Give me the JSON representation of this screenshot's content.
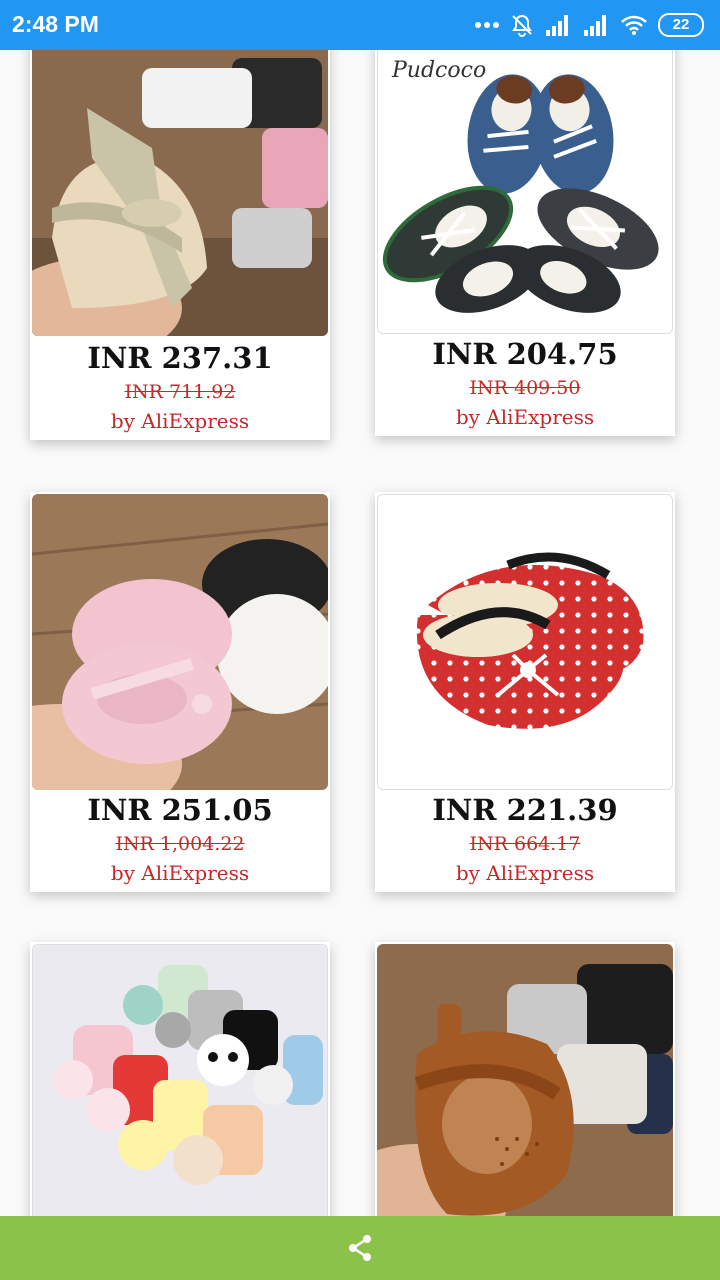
{
  "status_bar": {
    "time": "2:48 PM",
    "battery": "22"
  },
  "products": [
    {
      "price": "INR 237.31",
      "original_price": "INR 711.92",
      "seller": "by AliExpress",
      "image": "silver-glitter-baby-sandals"
    },
    {
      "price": "INR 204.75",
      "original_price": "INR 409.50",
      "seller": "by AliExpress",
      "image": "baby-boat-shoes",
      "brand_mark": "Pudcoco"
    },
    {
      "price": "INR 251.05",
      "original_price": "INR 1,004.22",
      "seller": "by AliExpress",
      "image": "pink-bow-baby-shoes"
    },
    {
      "price": "INR 221.39",
      "original_price": "INR 664.17",
      "seller": "by AliExpress",
      "image": "red-polka-dot-baby-shoes"
    },
    {
      "image": "animal-baby-socks"
    },
    {
      "image": "brown-baby-sandals"
    }
  ],
  "bottom_bar": {
    "icon": "share-icon"
  },
  "colors": {
    "status_bar": "#2196f3",
    "bottom_bar": "#8bc34a",
    "discount": "#c62828"
  }
}
